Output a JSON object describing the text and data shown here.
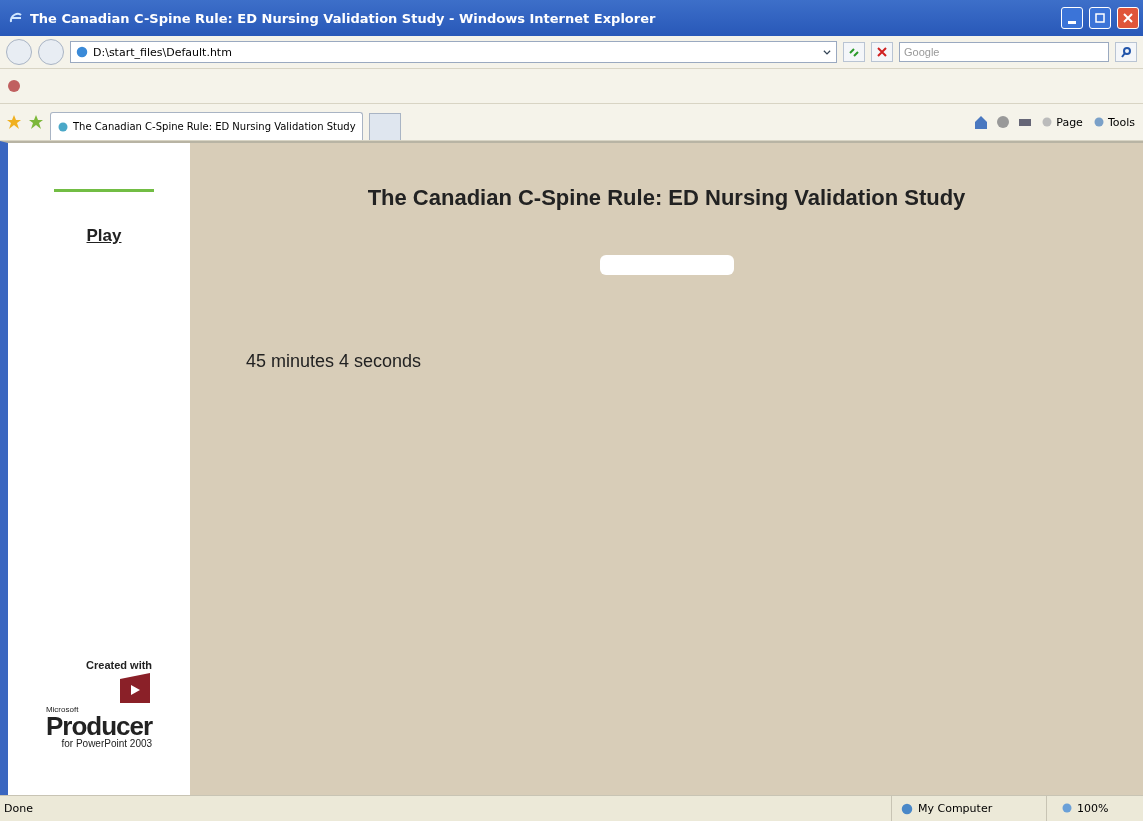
{
  "window": {
    "title": "The Canadian C-Spine Rule: ED Nursing Validation Study - Windows Internet Explorer"
  },
  "address_bar": {
    "value": "D:\\start_files\\Default.htm"
  },
  "search": {
    "placeholder": "Google"
  },
  "tabs": [
    {
      "label": "The Canadian C-Spine Rule: ED Nursing Validation Study",
      "selected": true
    }
  ],
  "command_bar": {
    "page": "Page",
    "tools": "Tools"
  },
  "sidebar": {
    "play": "Play",
    "created_with": "Created with",
    "logo_small": "Microsoft",
    "logo_name": "Producer",
    "logo_sub": "for PowerPoint 2003"
  },
  "content": {
    "title": "The Canadian C-Spine Rule: ED Nursing Validation Study",
    "duration": "45 minutes 4 seconds"
  },
  "status_bar": {
    "status": "Done",
    "zone": "My Computer",
    "zoom": "100%"
  }
}
